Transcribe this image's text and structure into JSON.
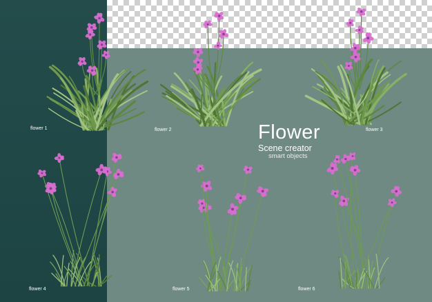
{
  "title": {
    "main": "Flower",
    "sub": "Scene creator",
    "tag": "smart objects"
  },
  "flowers": [
    {
      "label": "flower 1"
    },
    {
      "label": "flower 2"
    },
    {
      "label": "flower 3"
    },
    {
      "label": "flower 4"
    },
    {
      "label": "flower 5"
    },
    {
      "label": "flower 6"
    }
  ],
  "colors": {
    "dark_panel": "#1f4847",
    "sage_background": "#6f8a82",
    "petal": "#d66fd0",
    "grass": "#7ea65e"
  }
}
